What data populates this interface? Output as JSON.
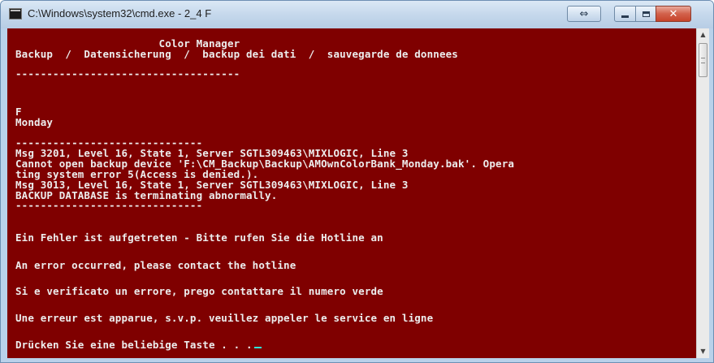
{
  "window": {
    "title": "C:\\Windows\\system32\\cmd.exe - 2_4  F",
    "buttons": {
      "resize_glyph": "⇔",
      "close_glyph": "✕"
    }
  },
  "console": {
    "background_color": "#7f0000",
    "text_color": "#ededed",
    "cursor_color": "#2fe6d8",
    "lines": [
      "                       Color Manager",
      "Backup  /  Datensicherung  /  backup dei dati  /  sauvegarde de donnees",
      "------------------------------------",
      "F",
      "Monday",
      "------------------------------",
      "Msg 3201, Level 16, State 1, Server SGTL309463\\MIXLOGIC, Line 3",
      "Cannot open backup device 'F:\\CM_Backup\\Backup\\AMOwnColorBank_Monday.bak'. Opera",
      "ting system error 5(Access is denied.).",
      "Msg 3013, Level 16, State 1, Server SGTL309463\\MIXLOGIC, Line 3",
      "BACKUP DATABASE is terminating abnormally.",
      "------------------------------",
      "Ein Fehler ist aufgetreten - Bitte rufen Sie die Hotline an",
      "An error occurred, please contact the hotline",
      "Si e verificato un errore, prego contattare il numero verde",
      "Une erreur est apparue, s.v.p. veuillez appeler le service en ligne",
      "Drücken Sie eine beliebige Taste . . ."
    ]
  },
  "scrollbar": {
    "up_glyph": "▲",
    "down_glyph": "▼"
  }
}
